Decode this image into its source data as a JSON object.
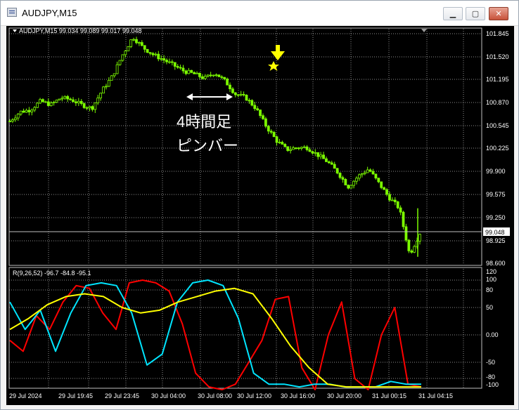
{
  "window": {
    "title": "AUDJPY,M15",
    "buttons": {
      "minimize": "▁",
      "maximize": "▢",
      "close": "✕"
    }
  },
  "colors": {
    "background": "#000000",
    "grid": "#ffffff",
    "bull_candle": "#7CFC00",
    "price_line": "#c0c0c0",
    "rsi_line": "#ff0000",
    "stoch_line": "#00e5ff",
    "signal_line": "#ffff00",
    "annotation_arrow": "#ffff00"
  },
  "main_chart": {
    "symbol_info": "AUDJPY,M15  99.034 99.089 99.017 99.048",
    "current_price_label": "99.048",
    "annotation_line1": "4時間足",
    "annotation_line2": "ピンバー",
    "marker_icon": "down-arrow-with-star",
    "price_axis": [
      "101.845",
      "101.520",
      "101.195",
      "100.870",
      "100.545",
      "100.225",
      "99.900",
      "99.575",
      "99.250",
      "98.925",
      "98.600"
    ]
  },
  "indicator": {
    "label": "R(9,26,52) -96.7 -84.8 -95.1",
    "axis": [
      "120",
      "100",
      "80",
      "50",
      "0.00",
      "-50",
      "-80",
      "-100"
    ]
  },
  "time_axis": [
    "29 Jul 2024",
    "29 Jul 19:45",
    "29 Jul 23:45",
    "30 Jul 04:00",
    "30 Jul 08:00",
    "30 Jul 12:00",
    "30 Jul 16:00",
    "30 Jul 20:00",
    "31 Jul 00:15",
    "31 Jul 04:15"
  ],
  "chart_data": {
    "type": "candlestick",
    "title": "AUDJPY,M15",
    "ylim": [
      98.6,
      101.845
    ],
    "x": [
      "29 Jul 2024",
      "29 Jul 19:45",
      "29 Jul 23:45",
      "30 Jul 04:00",
      "30 Jul 08:00",
      "30 Jul 12:00",
      "30 Jul 16:00",
      "30 Jul 20:00",
      "31 Jul 00:15",
      "31 Jul 04:15"
    ],
    "series": [
      {
        "values": [
          100.62,
          100.75,
          100.78,
          100.9,
          100.85,
          100.95,
          100.92,
          100.85,
          100.8,
          101.05,
          101.25,
          101.55,
          101.8,
          101.65,
          101.55,
          101.48,
          101.4,
          101.32,
          101.28,
          101.22,
          101.3,
          101.18,
          101.0,
          100.95,
          100.8,
          100.55,
          100.35,
          100.22,
          100.25,
          100.25,
          100.15,
          100.05,
          99.9,
          99.7,
          99.85,
          99.95,
          99.75,
          99.55,
          99.4,
          98.75,
          99.05
        ]
      }
    ],
    "indicator_series": [
      {
        "values": [
          -10,
          -30,
          35,
          10,
          60,
          90,
          85,
          40,
          10,
          95,
          100,
          95,
          80,
          20,
          -70,
          -95,
          -100,
          -90,
          -50,
          -10,
          65,
          70,
          -60,
          -100,
          0,
          60,
          -80,
          -100,
          0,
          50,
          -90,
          -95
        ]
      },
      {
        "values": [
          60,
          10,
          45,
          -30,
          40,
          90,
          95,
          90,
          40,
          -55,
          -35,
          60,
          95,
          100,
          90,
          30,
          -70,
          -90,
          -90,
          -95,
          -90,
          -90,
          -95,
          -95,
          -95,
          -85,
          -90,
          -90
        ]
      },
      {
        "values": [
          10,
          30,
          55,
          70,
          75,
          70,
          50,
          40,
          45,
          60,
          70,
          80,
          85,
          75,
          30,
          -20,
          -60,
          -90,
          -95,
          -95,
          -95,
          -95,
          -95
        ]
      }
    ]
  }
}
